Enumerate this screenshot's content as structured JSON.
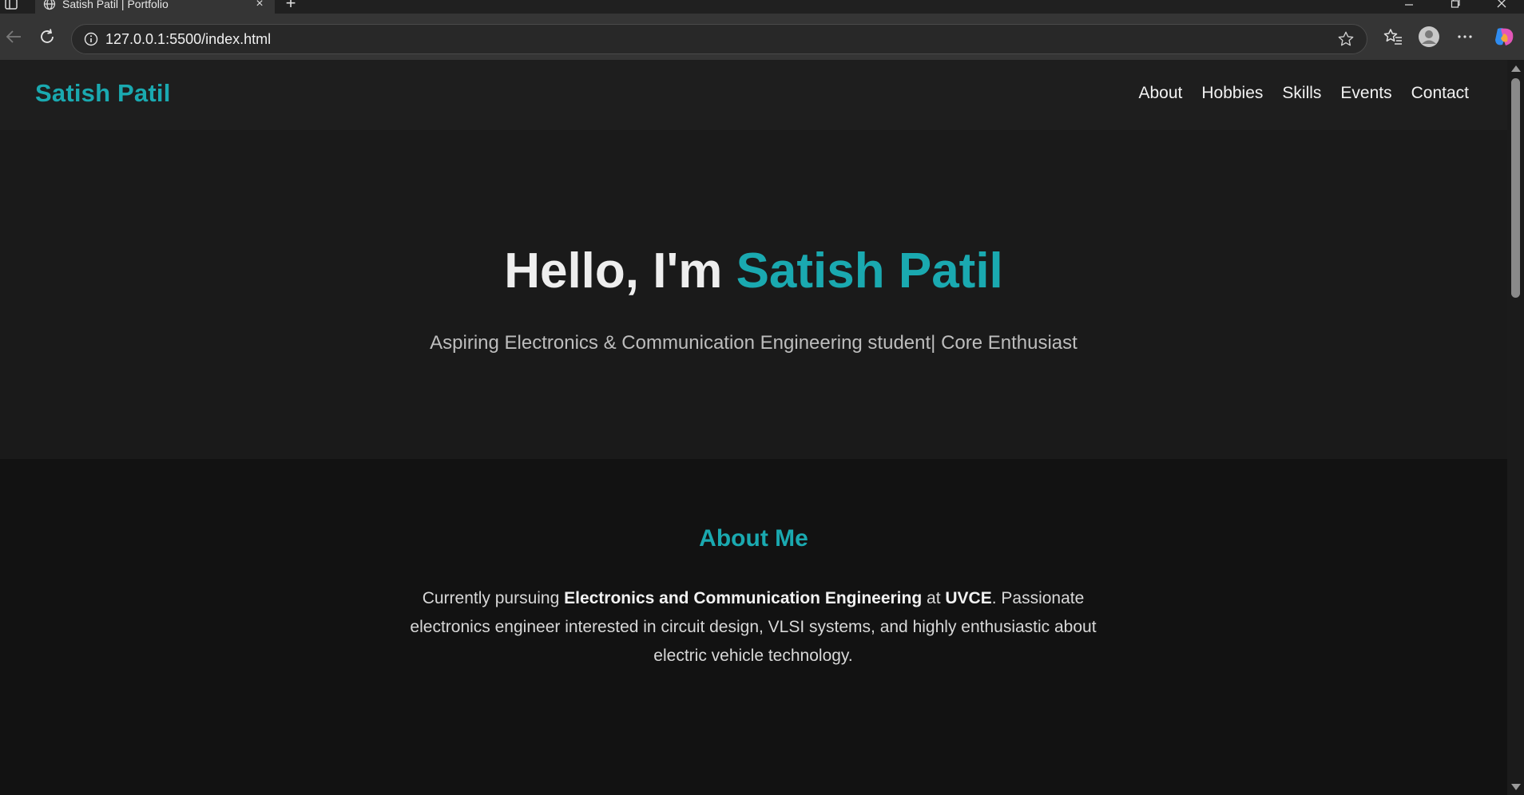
{
  "browser": {
    "tab_title": "Satish Patil | Portfolio",
    "url": "127.0.0.1:5500/index.html",
    "new_tab_glyph": "+",
    "close_tab_glyph": "×"
  },
  "site": {
    "logo": "Satish Patil",
    "nav": [
      "About",
      "Hobbies",
      "Skills",
      "Events",
      "Contact"
    ]
  },
  "hero": {
    "greeting": "Hello, I'm ",
    "name": "Satish Patil",
    "subtitle": "Aspiring Electronics & Communication Engineering student| Core Enthusiast"
  },
  "about": {
    "title": "About Me",
    "text_1": "Currently pursuing ",
    "text_bold_1": "Electronics and Communication Engineering",
    "text_2": " at ",
    "text_bold_2": "UVCE",
    "text_3": ". Passionate electronics engineer interested in circuit design, VLSI systems, and highly enthusiastic about electric vehicle technology."
  },
  "colors": {
    "accent": "#1aa9b0",
    "background": "#121212",
    "hero_background": "#1a1a1a",
    "header_background": "#1e1e1e"
  },
  "icons": [
    "sidebar-toggle-icon",
    "globe-icon",
    "back-icon",
    "refresh-icon",
    "info-icon",
    "star-icon",
    "favorites-icon",
    "profile-icon",
    "more-icon",
    "copilot-icon",
    "minimize-icon",
    "maximize-icon",
    "window-close-icon"
  ]
}
